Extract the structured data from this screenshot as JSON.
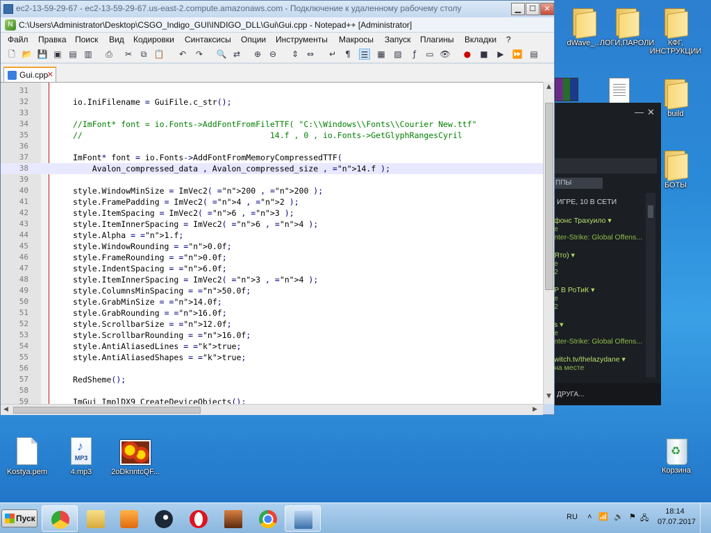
{
  "desktop": {
    "icons_right": [
      {
        "label": "dWave_...",
        "kind": "folder"
      },
      {
        "label": "ЛОГИ,ПАРОЛИ",
        "kind": "folder"
      },
      {
        "label": "КФГ, ИНСТРУКЦИИ",
        "kind": "folder"
      },
      {
        "label": "build",
        "kind": "folder"
      },
      {
        "label": "БОТЫ",
        "kind": "folder"
      },
      {
        "label": "Корзина",
        "kind": "recycle-bin"
      }
    ],
    "icons_bottom": [
      {
        "label": "Kostya.pem",
        "kind": "file"
      },
      {
        "label": "4.mp3",
        "kind": "mp3"
      },
      {
        "label": "2oDknntcQF...",
        "kind": "image"
      }
    ]
  },
  "rdp": {
    "title": "ec2-13-59-29-67 - ec2-13-59-29-67.us-east-2.compute.amazonaws.com - Подключение к удаленному рабочему столу"
  },
  "npp": {
    "title": "C:\\Users\\Administrator\\Desktop\\CSGO_Indigo_GUI\\INDIGO_DLL\\Gui\\Gui.cpp - Notepad++ [Administrator]",
    "menu": [
      "Файл",
      "Правка",
      "Поиск",
      "Вид",
      "Кодировки",
      "Синтаксисы",
      "Опции",
      "Инструменты",
      "Макросы",
      "Запуск",
      "Плагины",
      "Вкладки",
      "?"
    ],
    "tab": "Gui.cpp",
    "lines": [
      {
        "n": "31",
        "code": ""
      },
      {
        "n": "32",
        "code": "io.IniFilename = GuiFile.c_str();"
      },
      {
        "n": "33",
        "code": ""
      },
      {
        "n": "34",
        "code": "//ImFont* font = io.Fonts->AddFontFromFileTTF( \"C:\\\\Windows\\\\Fonts\\\\Courier New.ttf\""
      },
      {
        "n": "35",
        "code": "//                                       14.f , 0 , io.Fonts->GetGlyphRangesCyril"
      },
      {
        "n": "36",
        "code": ""
      },
      {
        "n": "37",
        "code": "ImFont* font = io.Fonts->AddFontFromMemoryCompressedTTF("
      },
      {
        "n": "38",
        "code": "    Avalon_compressed_data , Avalon_compressed_size , 14.f );"
      },
      {
        "n": "39",
        "code": ""
      },
      {
        "n": "40",
        "code": "style.WindowMinSize = ImVec2( 200 , 200 );"
      },
      {
        "n": "41",
        "code": "style.FramePadding = ImVec2( 4 , 2 );"
      },
      {
        "n": "42",
        "code": "style.ItemSpacing = ImVec2( 6 , 3 );"
      },
      {
        "n": "43",
        "code": "style.ItemInnerSpacing = ImVec2( 6 , 4 );"
      },
      {
        "n": "44",
        "code": "style.Alpha = 1.f;"
      },
      {
        "n": "45",
        "code": "style.WindowRounding = 0.0f;"
      },
      {
        "n": "46",
        "code": "style.FrameRounding = 0.0f;"
      },
      {
        "n": "47",
        "code": "style.IndentSpacing = 6.0f;"
      },
      {
        "n": "48",
        "code": "style.ItemInnerSpacing = ImVec2( 3 , 4 );"
      },
      {
        "n": "49",
        "code": "style.ColumnsMinSpacing = 50.0f;"
      },
      {
        "n": "50",
        "code": "style.GrabMinSize = 14.0f;"
      },
      {
        "n": "51",
        "code": "style.GrabRounding = 16.0f;"
      },
      {
        "n": "52",
        "code": "style.ScrollbarSize = 12.0f;"
      },
      {
        "n": "53",
        "code": "style.ScrollbarRounding = 16.0f;"
      },
      {
        "n": "54",
        "code": "style.AntiAliasedLines = true;"
      },
      {
        "n": "55",
        "code": "style.AntiAliasedShapes = true;"
      },
      {
        "n": "56",
        "code": ""
      },
      {
        "n": "57",
        "code": "RedSheme();"
      },
      {
        "n": "58",
        "code": ""
      },
      {
        "n": "59",
        "code": "ImGui_ImplDX9_CreateDeviceObjects();"
      }
    ]
  },
  "steam": {
    "groups_tab": "ППЫ",
    "in_game_header": "ИГРЕ, 10 В СЕТИ",
    "friends": [
      {
        "name": "фонс Трахуило",
        "status1": "е",
        "status2": "nter-Strike: Global Offens..."
      },
      {
        "name": "Ято)",
        "status1": "е",
        "status2": "2"
      },
      {
        "name": "Р В РоТиК",
        "status1": "е",
        "status2": "2"
      },
      {
        "name": "s",
        "status1": "е",
        "status2": "nter-Strike: Global Offens..."
      },
      {
        "name": "witch.tv/thelazydane",
        "status1": "на месте",
        "status2": ""
      }
    ],
    "bottom_label": "ДРУГА..."
  },
  "taskbar": {
    "start_label": "Пуск",
    "lang": "RU",
    "time": "18:14",
    "date": "07.07.2017"
  }
}
